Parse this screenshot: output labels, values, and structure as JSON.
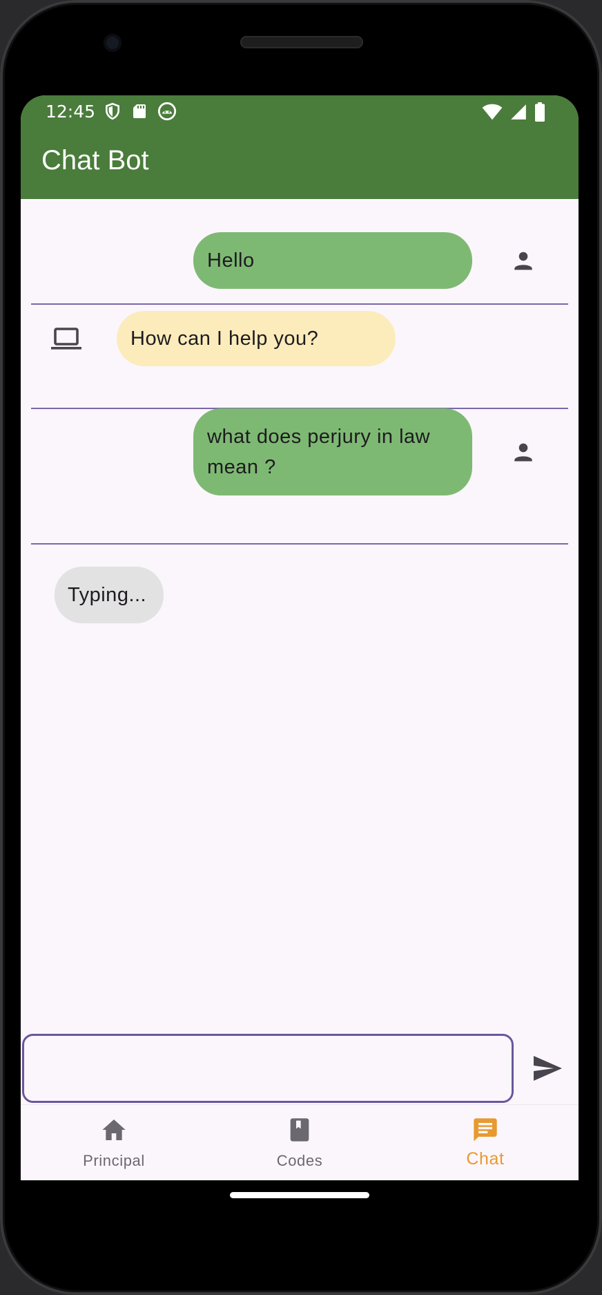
{
  "status": {
    "time": "12:45",
    "left_icons": [
      "shield-icon",
      "sd-card-icon",
      "android-icon"
    ],
    "right_icons": [
      "wifi-icon",
      "signal-icon",
      "battery-icon"
    ]
  },
  "appbar": {
    "title": "Chat Bot",
    "color": "#4a7c3b"
  },
  "messages": [
    {
      "sender": "user",
      "text": "Hello",
      "icon": "person-icon"
    },
    {
      "sender": "bot",
      "text": "How can I help you?",
      "icon": "laptop-icon"
    },
    {
      "sender": "user",
      "text": "what does perjury in law mean ?",
      "icon": "person-icon"
    },
    {
      "sender": "bot",
      "text": "Typing...",
      "icon": ""
    }
  ],
  "composer": {
    "value": "",
    "placeholder": "",
    "send_icon": "send-icon"
  },
  "nav": {
    "items": [
      {
        "label": "Principal",
        "icon": "home-icon",
        "active": false
      },
      {
        "label": "Codes",
        "icon": "book-icon",
        "active": false
      },
      {
        "label": "Chat",
        "icon": "chat-icon",
        "active": true
      }
    ],
    "active_color": "#e89a2e",
    "inactive_color": "#6c6870"
  },
  "colors": {
    "user_bubble": "#7eb973",
    "bot_bubble": "#fcecbb",
    "typing_bubble": "#e2e2e2",
    "divider": "#7a68a8",
    "background": "#fbf6fc"
  }
}
